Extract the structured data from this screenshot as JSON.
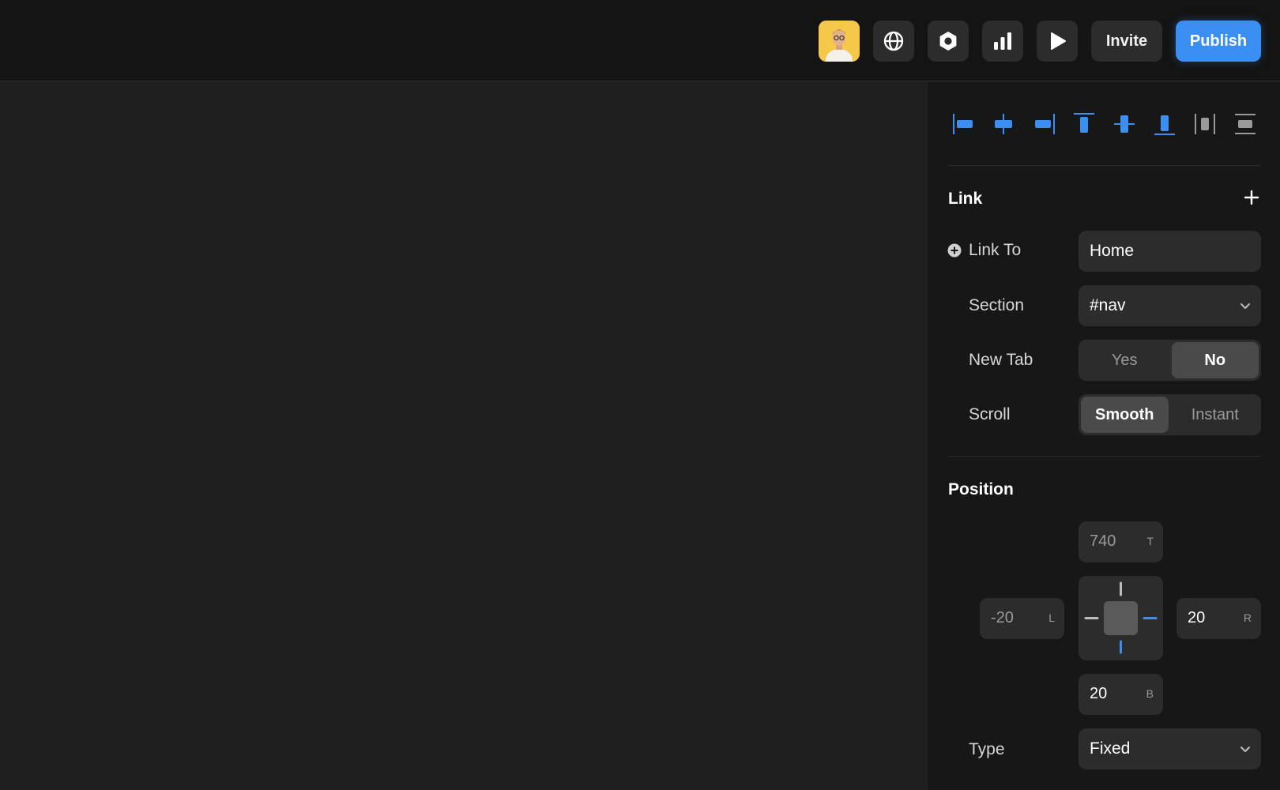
{
  "toolbar": {
    "avatar": "avatar",
    "icons": [
      "globe-icon",
      "hexagon-settings-icon",
      "bar-chart-icon",
      "play-icon"
    ],
    "invite_label": "Invite",
    "publish_label": "Publish"
  },
  "alignment": {
    "icons": [
      "align-left-icon",
      "align-horizontal-center-icon",
      "align-right-icon",
      "align-top-icon",
      "align-vertical-center-icon",
      "align-bottom-icon",
      "distribute-horizontal-icon",
      "distribute-vertical-icon"
    ]
  },
  "link": {
    "title": "Link",
    "link_to_label": "Link To",
    "link_to_value": "Home",
    "section_label": "Section",
    "section_value": "#nav",
    "new_tab_label": "New Tab",
    "new_tab_options": [
      "Yes",
      "No"
    ],
    "new_tab_selected": "No",
    "scroll_label": "Scroll",
    "scroll_options": [
      "Smooth",
      "Instant"
    ],
    "scroll_selected": "Smooth"
  },
  "position": {
    "title": "Position",
    "top": "740",
    "top_tag": "T",
    "left": "-20",
    "left_tag": "L",
    "right": "20",
    "right_tag": "R",
    "bottom": "20",
    "bottom_tag": "B",
    "type_label": "Type",
    "type_value": "Fixed"
  },
  "colors": {
    "accent": "#3b8ff2",
    "panel_bg": "#171717",
    "canvas_bg": "#1e1e1e",
    "field_bg": "#2c2c2c"
  }
}
